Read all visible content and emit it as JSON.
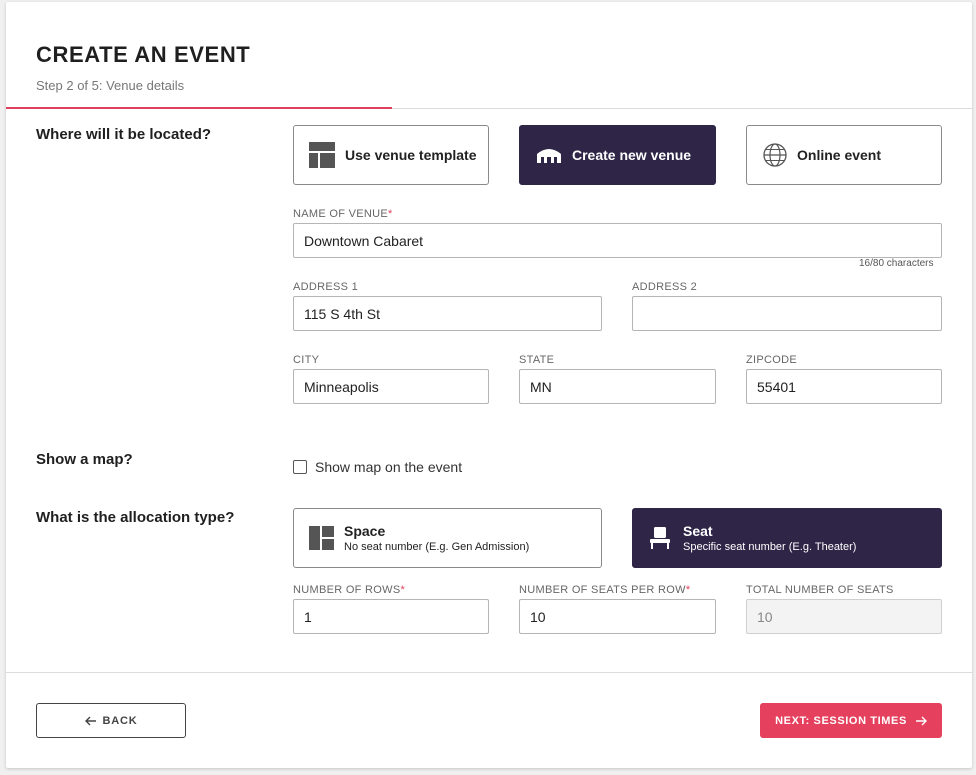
{
  "header": {
    "title": "CREATE AN EVENT",
    "step": "Step 2 of 5: Venue details",
    "progress": 0.4
  },
  "location": {
    "question": "Where will it be located?",
    "options": [
      {
        "label": "Use venue template",
        "icon": "venue-template-icon",
        "selected": false
      },
      {
        "label": "Create new venue",
        "icon": "stadium-icon",
        "selected": true
      },
      {
        "label": "Online event",
        "icon": "globe-icon",
        "selected": false
      }
    ]
  },
  "venue": {
    "name_label": "NAME OF VENUE",
    "name_required": "*",
    "name_value": "Downtown Cabaret",
    "name_char_count": "16/80 characters",
    "address1_label": "ADDRESS 1",
    "address1_value": "115 S 4th St",
    "address2_label": "ADDRESS 2",
    "address2_value": "",
    "city_label": "CITY",
    "city_value": "Minneapolis",
    "state_label": "STATE",
    "state_value": "MN",
    "zip_label": "ZIPCODE",
    "zip_value": "55401"
  },
  "map": {
    "question": "Show a map?",
    "checkbox_label": "Show map on the event",
    "checked": false
  },
  "allocation": {
    "question": "What is the allocation type?",
    "options": [
      {
        "title": "Space",
        "subtitle": "No seat number (E.g. Gen Admission)",
        "icon": "space-layout-icon",
        "selected": false
      },
      {
        "title": "Seat",
        "subtitle": "Specific seat number (E.g. Theater)",
        "icon": "seat-icon",
        "selected": true
      }
    ],
    "rows_label": "NUMBER OF ROWS",
    "rows_required": "*",
    "rows_value": "1",
    "seats_label": "NUMBER OF SEATS PER ROW",
    "seats_required": "*",
    "seats_value": "10",
    "total_label": "TOTAL NUMBER OF SEATS",
    "total_value": "10"
  },
  "footer": {
    "back_label": "BACK",
    "next_label": "NEXT: SESSION TIMES"
  },
  "colors": {
    "accent": "#e5405e",
    "selected": "#2e2547"
  }
}
